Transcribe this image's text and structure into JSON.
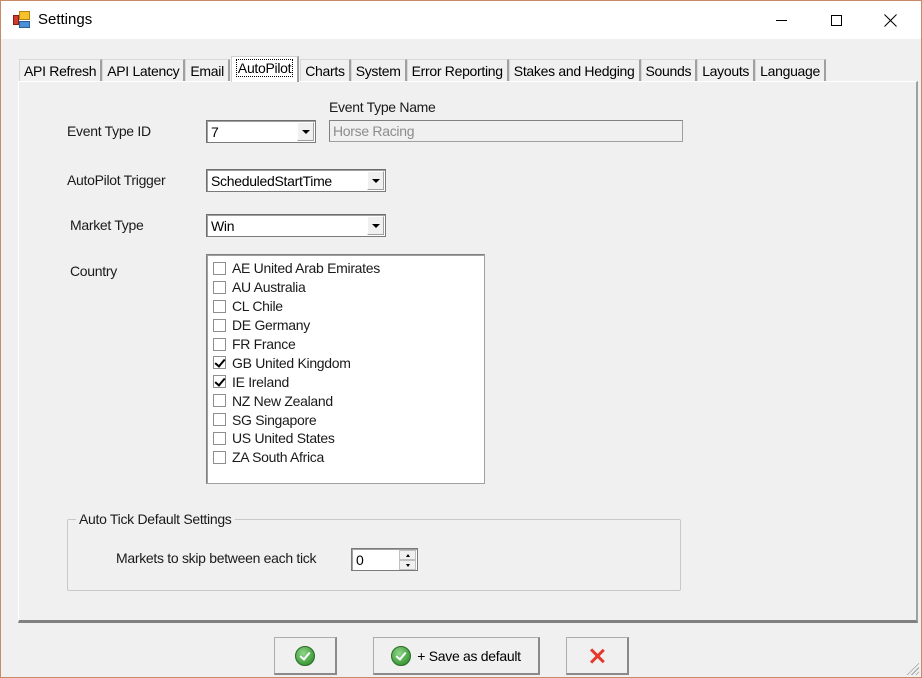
{
  "window": {
    "title": "Settings",
    "controls": {
      "minimize": "minimize",
      "maximize": "maximize",
      "close": "close"
    }
  },
  "tabs": [
    {
      "label": "API Refresh",
      "active": false
    },
    {
      "label": "API Latency",
      "active": false
    },
    {
      "label": "Email",
      "active": false
    },
    {
      "label": "AutoPilot",
      "active": true
    },
    {
      "label": "Charts",
      "active": false
    },
    {
      "label": "System",
      "active": false
    },
    {
      "label": "Error Reporting",
      "active": false
    },
    {
      "label": "Stakes and Hedging",
      "active": false
    },
    {
      "label": "Sounds",
      "active": false
    },
    {
      "label": "Layouts",
      "active": false
    },
    {
      "label": "Language",
      "active": false
    }
  ],
  "autopilot": {
    "event_type_id": {
      "label": "Event Type ID",
      "value": "7"
    },
    "event_type_name": {
      "label": "Event Type Name",
      "value": "Horse Racing"
    },
    "trigger": {
      "label": "AutoPilot Trigger",
      "value": "ScheduledStartTime"
    },
    "market_type": {
      "label": "Market Type",
      "value": "Win"
    },
    "country": {
      "label": "Country",
      "items": [
        {
          "label": "AE United Arab Emirates",
          "checked": false
        },
        {
          "label": "AU Australia",
          "checked": false
        },
        {
          "label": "CL Chile",
          "checked": false
        },
        {
          "label": "DE Germany",
          "checked": false
        },
        {
          "label": "FR France",
          "checked": false
        },
        {
          "label": "GB United Kingdom",
          "checked": true
        },
        {
          "label": "IE Ireland",
          "checked": true
        },
        {
          "label": "NZ New Zealand",
          "checked": false
        },
        {
          "label": "SG Singapore",
          "checked": false
        },
        {
          "label": "US United States",
          "checked": false
        },
        {
          "label": "ZA South Africa",
          "checked": false
        }
      ]
    },
    "auto_tick": {
      "legend": "Auto Tick Default Settings",
      "skip_label": "Markets to skip between each tick",
      "skip_value": "0"
    }
  },
  "buttons": {
    "ok_icon": "check-icon",
    "save_default_label": "+ Save as default",
    "cancel_icon": "x-icon"
  },
  "colors": {
    "ok_green": "#3f9c3a",
    "cancel_red": "#e53b2c",
    "window_border": "#c98a6a"
  }
}
